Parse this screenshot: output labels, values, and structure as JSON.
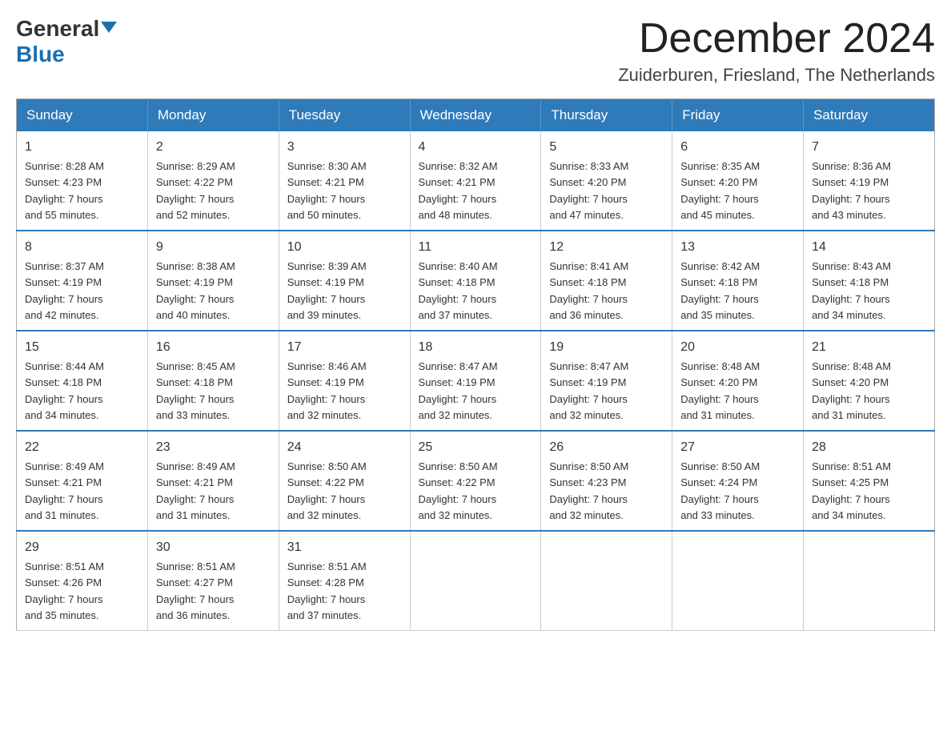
{
  "logo": {
    "general": "General",
    "blue": "Blue"
  },
  "title": {
    "month": "December 2024",
    "location": "Zuiderburen, Friesland, The Netherlands"
  },
  "weekdays": [
    "Sunday",
    "Monday",
    "Tuesday",
    "Wednesday",
    "Thursday",
    "Friday",
    "Saturday"
  ],
  "weeks": [
    [
      {
        "day": "1",
        "sunrise": "8:28 AM",
        "sunset": "4:23 PM",
        "daylight": "7 hours and 55 minutes."
      },
      {
        "day": "2",
        "sunrise": "8:29 AM",
        "sunset": "4:22 PM",
        "daylight": "7 hours and 52 minutes."
      },
      {
        "day": "3",
        "sunrise": "8:30 AM",
        "sunset": "4:21 PM",
        "daylight": "7 hours and 50 minutes."
      },
      {
        "day": "4",
        "sunrise": "8:32 AM",
        "sunset": "4:21 PM",
        "daylight": "7 hours and 48 minutes."
      },
      {
        "day": "5",
        "sunrise": "8:33 AM",
        "sunset": "4:20 PM",
        "daylight": "7 hours and 47 minutes."
      },
      {
        "day": "6",
        "sunrise": "8:35 AM",
        "sunset": "4:20 PM",
        "daylight": "7 hours and 45 minutes."
      },
      {
        "day": "7",
        "sunrise": "8:36 AM",
        "sunset": "4:19 PM",
        "daylight": "7 hours and 43 minutes."
      }
    ],
    [
      {
        "day": "8",
        "sunrise": "8:37 AM",
        "sunset": "4:19 PM",
        "daylight": "7 hours and 42 minutes."
      },
      {
        "day": "9",
        "sunrise": "8:38 AM",
        "sunset": "4:19 PM",
        "daylight": "7 hours and 40 minutes."
      },
      {
        "day": "10",
        "sunrise": "8:39 AM",
        "sunset": "4:19 PM",
        "daylight": "7 hours and 39 minutes."
      },
      {
        "day": "11",
        "sunrise": "8:40 AM",
        "sunset": "4:18 PM",
        "daylight": "7 hours and 37 minutes."
      },
      {
        "day": "12",
        "sunrise": "8:41 AM",
        "sunset": "4:18 PM",
        "daylight": "7 hours and 36 minutes."
      },
      {
        "day": "13",
        "sunrise": "8:42 AM",
        "sunset": "4:18 PM",
        "daylight": "7 hours and 35 minutes."
      },
      {
        "day": "14",
        "sunrise": "8:43 AM",
        "sunset": "4:18 PM",
        "daylight": "7 hours and 34 minutes."
      }
    ],
    [
      {
        "day": "15",
        "sunrise": "8:44 AM",
        "sunset": "4:18 PM",
        "daylight": "7 hours and 34 minutes."
      },
      {
        "day": "16",
        "sunrise": "8:45 AM",
        "sunset": "4:18 PM",
        "daylight": "7 hours and 33 minutes."
      },
      {
        "day": "17",
        "sunrise": "8:46 AM",
        "sunset": "4:19 PM",
        "daylight": "7 hours and 32 minutes."
      },
      {
        "day": "18",
        "sunrise": "8:47 AM",
        "sunset": "4:19 PM",
        "daylight": "7 hours and 32 minutes."
      },
      {
        "day": "19",
        "sunrise": "8:47 AM",
        "sunset": "4:19 PM",
        "daylight": "7 hours and 32 minutes."
      },
      {
        "day": "20",
        "sunrise": "8:48 AM",
        "sunset": "4:20 PM",
        "daylight": "7 hours and 31 minutes."
      },
      {
        "day": "21",
        "sunrise": "8:48 AM",
        "sunset": "4:20 PM",
        "daylight": "7 hours and 31 minutes."
      }
    ],
    [
      {
        "day": "22",
        "sunrise": "8:49 AM",
        "sunset": "4:21 PM",
        "daylight": "7 hours and 31 minutes."
      },
      {
        "day": "23",
        "sunrise": "8:49 AM",
        "sunset": "4:21 PM",
        "daylight": "7 hours and 31 minutes."
      },
      {
        "day": "24",
        "sunrise": "8:50 AM",
        "sunset": "4:22 PM",
        "daylight": "7 hours and 32 minutes."
      },
      {
        "day": "25",
        "sunrise": "8:50 AM",
        "sunset": "4:22 PM",
        "daylight": "7 hours and 32 minutes."
      },
      {
        "day": "26",
        "sunrise": "8:50 AM",
        "sunset": "4:23 PM",
        "daylight": "7 hours and 32 minutes."
      },
      {
        "day": "27",
        "sunrise": "8:50 AM",
        "sunset": "4:24 PM",
        "daylight": "7 hours and 33 minutes."
      },
      {
        "day": "28",
        "sunrise": "8:51 AM",
        "sunset": "4:25 PM",
        "daylight": "7 hours and 34 minutes."
      }
    ],
    [
      {
        "day": "29",
        "sunrise": "8:51 AM",
        "sunset": "4:26 PM",
        "daylight": "7 hours and 35 minutes."
      },
      {
        "day": "30",
        "sunrise": "8:51 AM",
        "sunset": "4:27 PM",
        "daylight": "7 hours and 36 minutes."
      },
      {
        "day": "31",
        "sunrise": "8:51 AM",
        "sunset": "4:28 PM",
        "daylight": "7 hours and 37 minutes."
      },
      null,
      null,
      null,
      null
    ]
  ]
}
